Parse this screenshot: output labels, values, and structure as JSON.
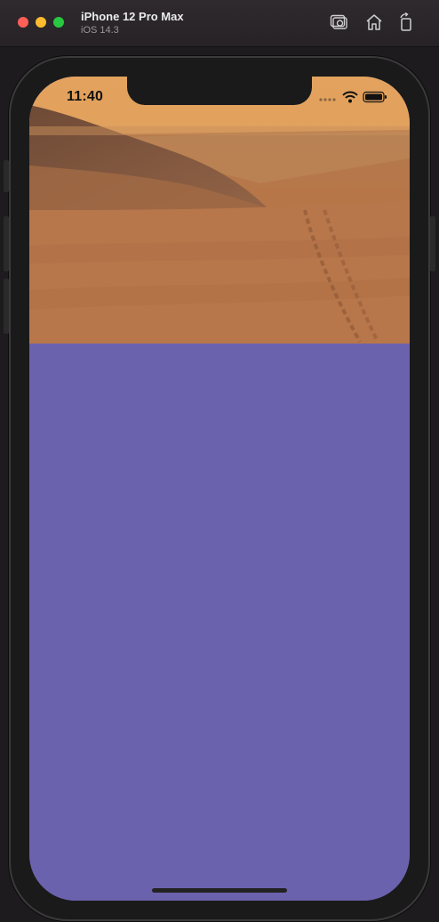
{
  "window": {
    "device_name": "iPhone 12 Pro Max",
    "os_version": "iOS 14.3"
  },
  "toolbar": {
    "icons": [
      "screenshot-icon",
      "home-icon",
      "rotate-icon"
    ]
  },
  "status_bar": {
    "time": "11:40",
    "icons": [
      "cellular-dots-icon",
      "wifi-icon",
      "battery-icon"
    ]
  },
  "content": {
    "image": "mars-landscape-photo",
    "background_color": "#6a62ad"
  }
}
